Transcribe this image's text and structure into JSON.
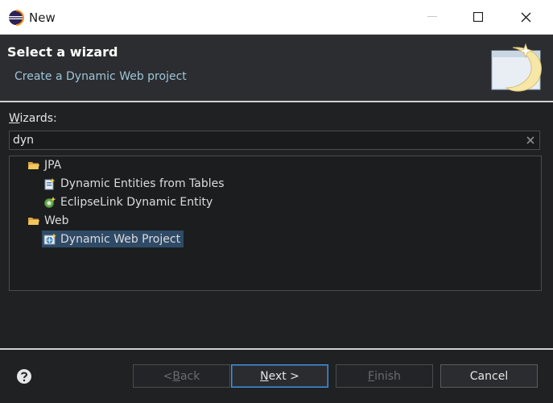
{
  "window": {
    "title": "New"
  },
  "header": {
    "title": "Select a wizard",
    "subtitle": "Create a Dynamic Web project"
  },
  "wizards": {
    "label_pre": "",
    "label_mnemonic": "W",
    "label_rest": "izards:"
  },
  "filter": {
    "value": "dyn"
  },
  "tree": {
    "jpa": "JPA",
    "dynamic_entities": "Dynamic Entities from Tables",
    "eclipselink_entity": "EclipseLink Dynamic Entity",
    "web": "Web",
    "dynamic_web_project": "Dynamic Web Project"
  },
  "buttons": {
    "back_pre": "< ",
    "back_mn": "B",
    "back_rest": "ack",
    "next_mn": "N",
    "next_rest": "ext >",
    "finish_mn": "F",
    "finish_rest": "inish",
    "cancel": "Cancel"
  },
  "colors": {
    "selection": "#2f4a66",
    "default_button_border": "#4a8fd6",
    "subtitle": "#9fc4d9"
  }
}
